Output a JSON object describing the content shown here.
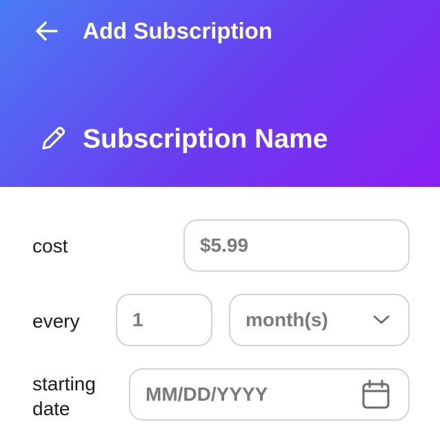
{
  "header": {
    "title": "Add Subscription",
    "back_icon": "arrow-left-icon"
  },
  "name_field": {
    "placeholder": "Subscription Name",
    "icon": "pencil-icon"
  },
  "cost": {
    "label": "cost",
    "value": "$5.99"
  },
  "every": {
    "label": "every",
    "count_value": "1",
    "unit_value": "month(s)",
    "unit_icon": "chevron-down-icon"
  },
  "starting_date": {
    "label_line1": "starting",
    "label_line2": "date",
    "placeholder": "MM/DD/YYYY",
    "icon": "calendar-icon"
  },
  "colors": {
    "gradient_start": "#4a7cf4",
    "gradient_end": "#8a1ff2",
    "field_border": "#d3d3d3",
    "field_text": "#7a7a7a"
  }
}
